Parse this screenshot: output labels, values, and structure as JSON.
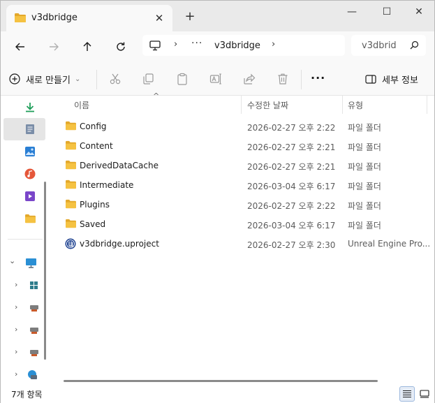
{
  "window": {
    "tab_title": "v3dbridge",
    "new_tab_label": "+",
    "minimize_label": "—",
    "maximize_label": "☐",
    "close_label": "✕"
  },
  "address": {
    "separator": "›",
    "overflow": "···",
    "crumb": "v3dbridge"
  },
  "search": {
    "text": "v3dbrid"
  },
  "commands": {
    "new_label": "새로 만들기",
    "more_label": "···",
    "details_label": "세부 정보"
  },
  "columns": {
    "name": "이름",
    "date": "수정한 날짜",
    "type": "유형"
  },
  "files": [
    {
      "name": "Config",
      "date": "2026-02-27 오후 2:22",
      "type": "파일 폴더",
      "icon": "folder-icon"
    },
    {
      "name": "Content",
      "date": "2026-02-27 오후 2:21",
      "type": "파일 폴더",
      "icon": "folder-icon"
    },
    {
      "name": "DerivedDataCache",
      "date": "2026-02-27 오후 2:21",
      "type": "파일 폴더",
      "icon": "folder-icon"
    },
    {
      "name": "Intermediate",
      "date": "2026-03-04 오후 6:17",
      "type": "파일 폴더",
      "icon": "folder-icon"
    },
    {
      "name": "Plugins",
      "date": "2026-02-27 오후 2:22",
      "type": "파일 폴더",
      "icon": "folder-icon"
    },
    {
      "name": "Saved",
      "date": "2026-03-04 오후 6:17",
      "type": "파일 폴더",
      "icon": "folder-icon"
    },
    {
      "name": "v3dbridge.uproject",
      "date": "2026-02-27 오후 2:30",
      "type": "Unreal Engine Pro...",
      "icon": "unreal-engine-icon"
    }
  ],
  "status": {
    "item_count": "7개 항목"
  },
  "colors": {
    "folder": "#f5c242",
    "folder_dark": "#e3a82b",
    "download": "#1f9e5a",
    "pictures": "#2a7fd4",
    "music": "#e5573a",
    "videos": "#7a46c9",
    "pc": "#2a8fd4"
  }
}
